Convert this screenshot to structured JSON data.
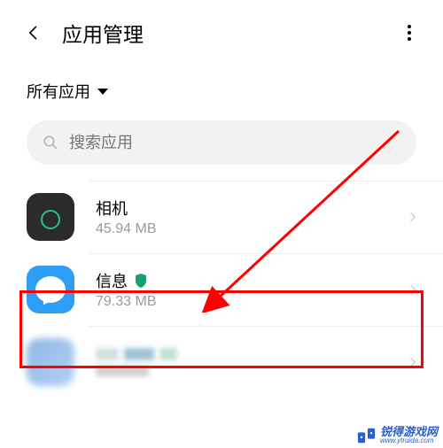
{
  "header": {
    "title": "应用管理"
  },
  "filter": {
    "label": "所有应用"
  },
  "search": {
    "placeholder": "搜索应用"
  },
  "apps": [
    {
      "name": "相机",
      "size": "45.94 MB",
      "shield": false
    },
    {
      "name": "信息",
      "size": "79.33 MB",
      "shield": true
    }
  ],
  "watermark": {
    "name": "锐得游戏网",
    "url": "www.ytruida.com"
  }
}
